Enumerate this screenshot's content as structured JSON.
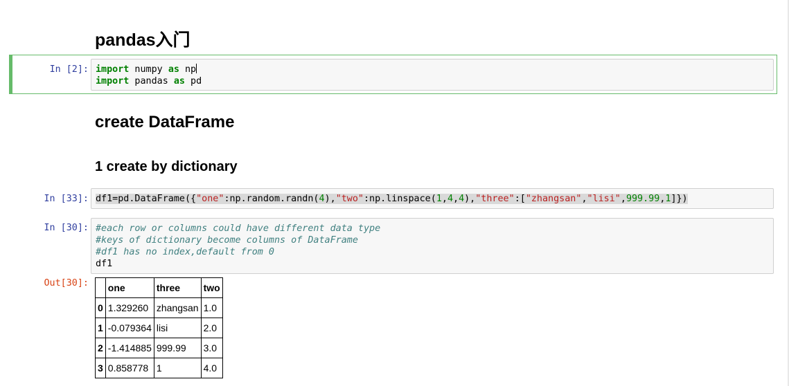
{
  "headings": {
    "title": "pandas入门",
    "create_dataframe": "create DataFrame",
    "by_dictionary": "1 create by dictionary"
  },
  "cells": [
    {
      "prompt": "In [2]:",
      "lines": [
        [
          {
            "t": "import",
            "c": "kw"
          },
          {
            "t": " numpy "
          },
          {
            "t": "as",
            "c": "kw"
          },
          {
            "t": " np"
          }
        ],
        [
          {
            "t": "import",
            "c": "kw"
          },
          {
            "t": " pandas "
          },
          {
            "t": "as",
            "c": "kw"
          },
          {
            "t": " pd"
          }
        ]
      ]
    },
    {
      "prompt": "In [33]:",
      "lines": [
        [
          {
            "t": "df1=pd.DataFrame({"
          },
          {
            "t": "\"one\"",
            "c": "str"
          },
          {
            "t": ":np.random.randn("
          },
          {
            "t": "4",
            "c": "num"
          },
          {
            "t": "),"
          },
          {
            "t": "\"two\"",
            "c": "str"
          },
          {
            "t": ":np.linspace("
          },
          {
            "t": "1",
            "c": "num"
          },
          {
            "t": ","
          },
          {
            "t": "4",
            "c": "num"
          },
          {
            "t": ","
          },
          {
            "t": "4",
            "c": "num"
          },
          {
            "t": "),"
          },
          {
            "t": "\"three\"",
            "c": "str"
          },
          {
            "t": ":["
          },
          {
            "t": "\"zhangsan\"",
            "c": "str"
          },
          {
            "t": ","
          },
          {
            "t": "\"lisi\"",
            "c": "str"
          },
          {
            "t": ","
          },
          {
            "t": "999.99",
            "c": "num"
          },
          {
            "t": ","
          },
          {
            "t": "1",
            "c": "num"
          },
          {
            "t": "]})"
          }
        ]
      ]
    },
    {
      "prompt": "In [30]:",
      "lines": [
        [
          {
            "t": "#each row or columns could have different data type",
            "c": "cmt"
          }
        ],
        [
          {
            "t": "#keys of dictionary become columns of DataFrame",
            "c": "cmt"
          }
        ],
        [
          {
            "t": "#df1 has no index,default from 0",
            "c": "cmt"
          }
        ],
        [
          {
            "t": "df1"
          }
        ]
      ]
    }
  ],
  "output": {
    "prompt": "Out[30]:",
    "columns": [
      "",
      "one",
      "three",
      "two"
    ],
    "rows": [
      [
        "0",
        "1.329260",
        "zhangsan",
        "1.0"
      ],
      [
        "1",
        "-0.079364",
        "lisi",
        "2.0"
      ],
      [
        "2",
        "-1.414885",
        "999.99",
        "3.0"
      ],
      [
        "3",
        "0.858778",
        "1",
        "4.0"
      ]
    ]
  }
}
